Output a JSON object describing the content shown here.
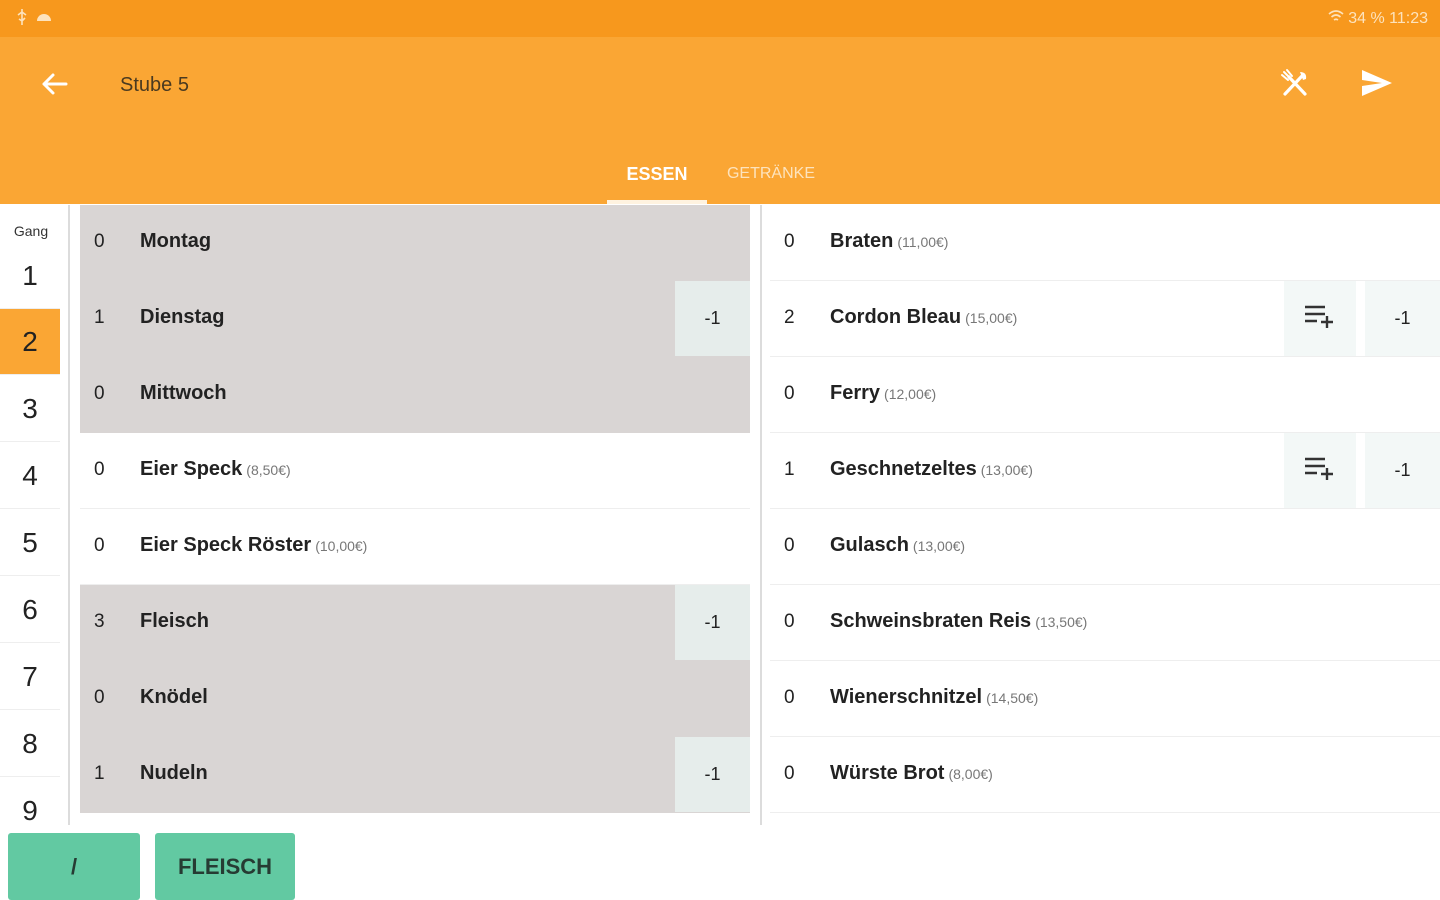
{
  "status_bar": {
    "right_text": "34 % 11:23",
    "icons": [
      "usb-icon",
      "android-icon",
      "wifi-icon",
      "battery-icon"
    ]
  },
  "app_bar": {
    "title": "Stube 5",
    "back_icon": "arrow-left-icon",
    "cutlery_icon": "cutlery-crossed-icon",
    "send_icon": "send-icon"
  },
  "tabs": [
    {
      "label": "ESSEN",
      "active": true
    },
    {
      "label": "GETRÄNKE",
      "active": false
    }
  ],
  "gang": {
    "label": "Gang",
    "items": [
      "1",
      "2",
      "3",
      "4",
      "5",
      "6",
      "7",
      "8",
      "9"
    ],
    "selected": "2"
  },
  "categories": [
    {
      "count": "0",
      "name": "Montag",
      "price": "",
      "highlight": true,
      "minus": ""
    },
    {
      "count": "1",
      "name": "Dienstag",
      "price": "",
      "highlight": true,
      "minus": "-1"
    },
    {
      "count": "0",
      "name": "Mittwoch",
      "price": "",
      "highlight": true,
      "minus": ""
    },
    {
      "count": "0",
      "name": "Eier Speck",
      "price": "(8,50€)",
      "highlight": false,
      "minus": ""
    },
    {
      "count": "0",
      "name": "Eier Speck Röster",
      "price": "(10,00€)",
      "highlight": false,
      "minus": ""
    },
    {
      "count": "3",
      "name": "Fleisch",
      "price": "",
      "highlight": true,
      "minus": "-1"
    },
    {
      "count": "0",
      "name": "Knödel",
      "price": "",
      "highlight": true,
      "minus": ""
    },
    {
      "count": "1",
      "name": "Nudeln",
      "price": "",
      "highlight": true,
      "minus": "-1"
    }
  ],
  "items": [
    {
      "count": "0",
      "name": "Braten",
      "price": "(11,00€)",
      "minus": "",
      "note": false
    },
    {
      "count": "2",
      "name": "Cordon Bleau",
      "price": "(15,00€)",
      "minus": "-1",
      "note": true
    },
    {
      "count": "0",
      "name": "Ferry",
      "price": "(12,00€)",
      "minus": "",
      "note": false
    },
    {
      "count": "1",
      "name": "Geschnetzeltes",
      "price": "(13,00€)",
      "minus": "-1",
      "note": true
    },
    {
      "count": "0",
      "name": "Gulasch",
      "price": "(13,00€)",
      "minus": "",
      "note": false
    },
    {
      "count": "0",
      "name": "Schweinsbraten Reis",
      "price": "(13,50€)",
      "minus": "",
      "note": false
    },
    {
      "count": "0",
      "name": "Wienerschnitzel",
      "price": "(14,50€)",
      "minus": "",
      "note": false
    },
    {
      "count": "0",
      "name": "Würste Brot",
      "price": "(8,00€)",
      "minus": "",
      "note": false
    }
  ],
  "bottom_buttons": [
    "/",
    "FLEISCH"
  ],
  "colors": {
    "status_bar": "#f7981d",
    "app_bar": "#faa634",
    "selected_gang": "#faa634",
    "highlight_row": "#d9d5d4",
    "green_button": "#62c9a2"
  }
}
